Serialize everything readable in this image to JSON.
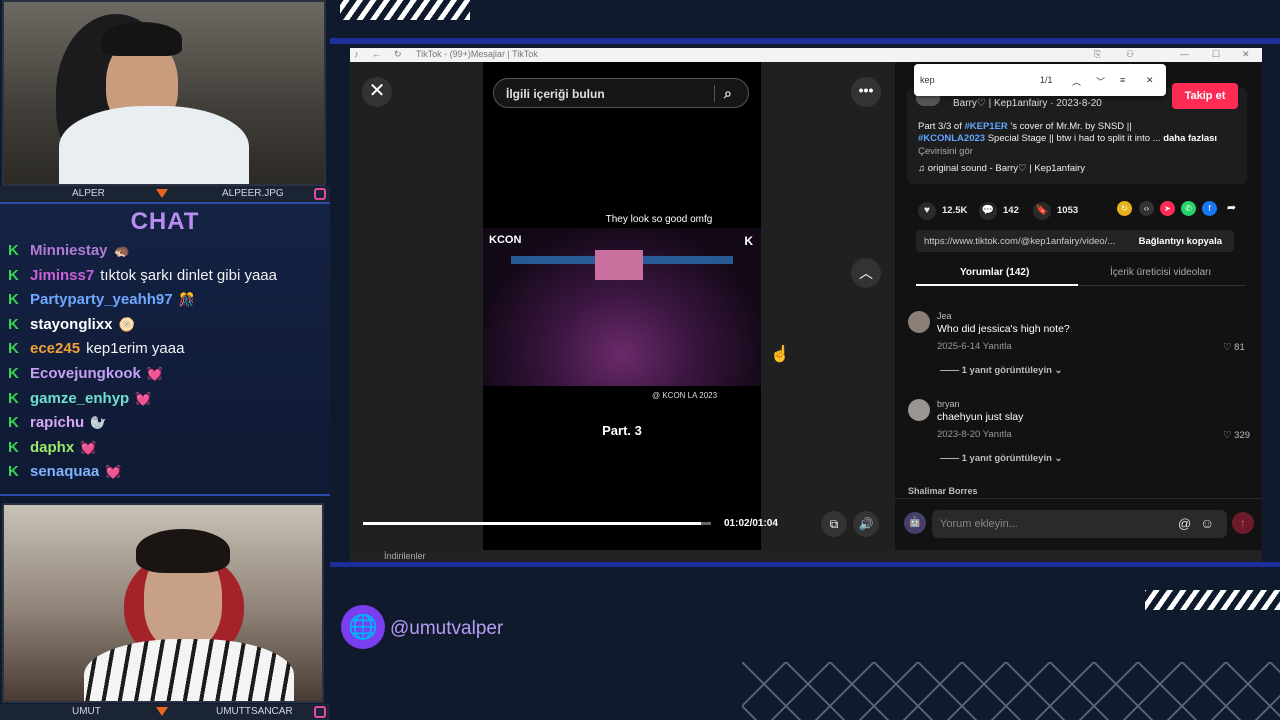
{
  "overlay": {
    "cam_top_label_left": "ALPER",
    "cam_top_label_right": "ALPEER.JPG",
    "cam_bottom_label_left": "UMUT",
    "cam_bottom_label_right": "UMUTTSANCAR",
    "chat_title": "CHAT",
    "social_handle": "@umutvalper",
    "chat": [
      {
        "user": "Minniestay",
        "color": "#b07ad6",
        "msg": "",
        "emoji": "🦔"
      },
      {
        "user": "Jiminss7",
        "color": "#c862d8",
        "msg": "tıktok şarkı dinlet gibi yaaa",
        "emoji": ""
      },
      {
        "user": "Partyparty_yeahh97",
        "color": "#6fa8ff",
        "msg": "",
        "emoji": "🎊"
      },
      {
        "user": "stayonglixx",
        "color": "#ffffff",
        "msg": "",
        "emoji": "🫓"
      },
      {
        "user": "ece245",
        "color": "#f0a23a",
        "msg": "kep1erim yaaa",
        "emoji": ""
      },
      {
        "user": "Ecovejungkook",
        "color": "#c6a0f4",
        "msg": "",
        "emoji": "💓"
      },
      {
        "user": "gamze_enhyp",
        "color": "#6fe0d0",
        "msg": "",
        "emoji": "💓"
      },
      {
        "user": "rapichu",
        "color": "#d9a6f5",
        "msg": "",
        "emoji": "🦭"
      },
      {
        "user": "daphx",
        "color": "#9be86a",
        "msg": "",
        "emoji": "💓"
      },
      {
        "user": "senaquaa",
        "color": "#7fb3ff",
        "msg": "",
        "emoji": "💓"
      }
    ]
  },
  "browser": {
    "title": "TikTok - (99+)Mesajlar | TikTok",
    "search_placeholder": "İlgili içeriği bulun",
    "video_caption": "They look so good omfg",
    "stage_logo": "KCON",
    "stage_corner": "K",
    "video_credit": "@ KCON LA 2023",
    "part_label": "Part. 3",
    "time": "01:02/01:04",
    "progress": 0.97,
    "find_query": "kep",
    "find_count": "1/1",
    "follow": "Takip et",
    "author_line": "Barry♡ | Kep1anfairy · 2023-8-20",
    "desc_prefix": "Part 3/3 of ",
    "desc_tag1": "#KEP1ER",
    "desc_mid": " 's cover of Mr.Mr. by SNSD ||",
    "desc_tag2": "#KCONLA2023",
    "desc_end": " Special Stage || btw i had to split it into ...",
    "desc_more": "daha fazlası",
    "translate": "Çevirisini gör",
    "sound": "original sound - Barry♡ | Kep1anfairy",
    "likes": "12.5K",
    "comments_count": "142",
    "saves": "1053",
    "url": "https://www.tiktok.com/@kep1anfairy/video/...",
    "copy_link": "Bağlantıyı kopyala",
    "tab_comments": "Yorumlar (142)",
    "tab_creator": "İçerik üreticisi videoları",
    "comments": [
      {
        "name": "Jea",
        "text": "Who did jessica's high note?",
        "date": "2025-6-14    Yanıtla",
        "likes": "♡ 81",
        "replies": "—— 1 yanıt görüntüleyin ⌄"
      },
      {
        "name": "bryan",
        "text": "chaehyun just slay",
        "date": "2023-8-20    Yanıtla",
        "likes": "♡ 329",
        "replies": "—— 1 yanıt görüntüleyin ⌄"
      }
    ],
    "peek_name": "Shalimar Borres",
    "comment_placeholder": "Yorum ekleyin...",
    "taskbar_text": "İndirilenler"
  }
}
